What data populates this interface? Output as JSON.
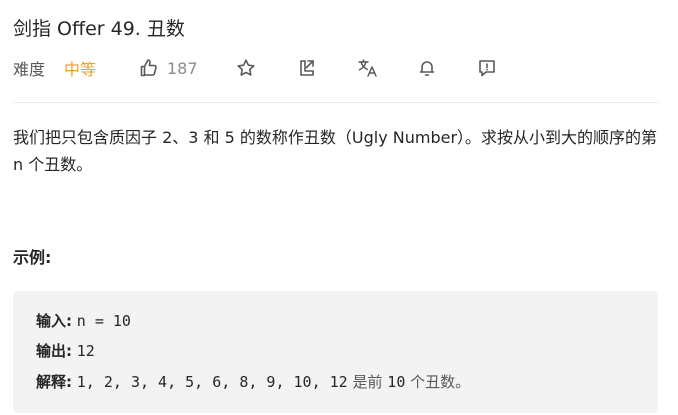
{
  "problem": {
    "title": "剑指 Offer 49. 丑数",
    "difficulty_label": "难度",
    "difficulty_value": "中等",
    "likes": "187"
  },
  "description": {
    "text": "我们把只包含质因子 2、3 和 5 的数称作丑数（Ugly Number）。求按从小到大的顺序的第 n 个丑数。"
  },
  "example": {
    "heading": "示例:",
    "input_label": "输入:",
    "input_value": "n = 10",
    "output_label": "输出:",
    "output_value": "12",
    "explain_label": "解释:",
    "explain_sequence": "1, 2, 3, 4, 5, 6, 8, 9, 10, 12",
    "explain_text_a": "是前",
    "explain_n": "10",
    "explain_text_b": "个丑数。"
  },
  "colors": {
    "difficulty_medium": "#f0a020",
    "code_bg": "#f3f3f3"
  },
  "icons": [
    "thumb-up-icon",
    "star-icon",
    "share-icon",
    "translate-icon",
    "bell-icon",
    "feedback-icon"
  ]
}
